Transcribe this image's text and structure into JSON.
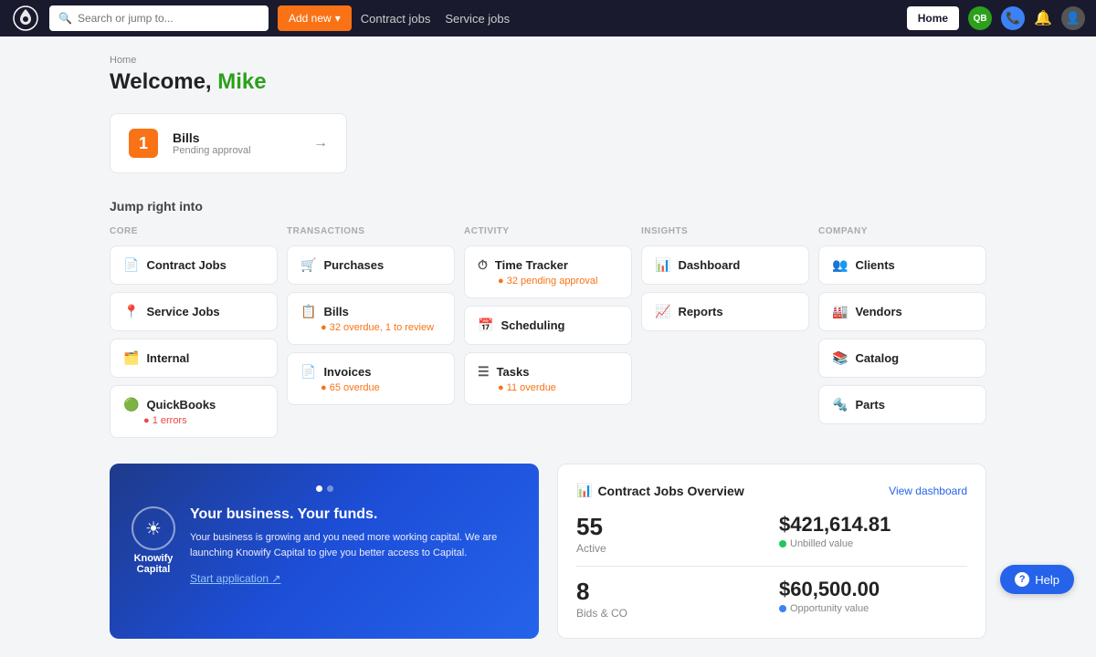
{
  "nav": {
    "logo_alt": "Knowify logo",
    "search_placeholder": "Search or jump to...",
    "btn_add_new": "Add new",
    "link_contract_jobs": "Contract jobs",
    "link_service_jobs": "Service jobs",
    "btn_home": "Home",
    "qb_label": "QB",
    "phone_icon": "📞",
    "bell_icon": "🔔",
    "user_icon": "👤"
  },
  "page": {
    "breadcrumb": "Home",
    "welcome_prefix": "Welcome, ",
    "welcome_name": "Mike"
  },
  "bills_card": {
    "badge": "1",
    "title": "Bills",
    "subtitle": "Pending approval",
    "arrow": "→"
  },
  "jump": {
    "title": "Jump right into",
    "columns": [
      {
        "label": "CORE",
        "items": [
          {
            "icon": "📄",
            "title": "Contract Jobs",
            "sub": "",
            "sub_class": ""
          },
          {
            "icon": "📍",
            "title": "Service Jobs",
            "sub": "",
            "sub_class": ""
          },
          {
            "icon": "🗂️",
            "title": "Internal",
            "sub": "",
            "sub_class": ""
          },
          {
            "icon": "🟢",
            "title": "QuickBooks",
            "sub": "● 1 errors",
            "sub_class": "red"
          }
        ]
      },
      {
        "label": "TRANSACTIONS",
        "items": [
          {
            "icon": "🛒",
            "title": "Purchases",
            "sub": "",
            "sub_class": ""
          },
          {
            "icon": "📋",
            "title": "Bills",
            "sub": "● 32 overdue, 1 to review",
            "sub_class": "orange"
          },
          {
            "icon": "📄",
            "title": "Invoices",
            "sub": "● 65 overdue",
            "sub_class": "orange"
          }
        ]
      },
      {
        "label": "ACTIVITY",
        "items": [
          {
            "icon": "⏱",
            "title": "Time Tracker",
            "sub": "● 32 pending approval",
            "sub_class": "orange"
          },
          {
            "icon": "📅",
            "title": "Scheduling",
            "sub": "",
            "sub_class": ""
          },
          {
            "icon": "☰",
            "title": "Tasks",
            "sub": "● 11 overdue",
            "sub_class": "orange"
          }
        ]
      },
      {
        "label": "INSIGHTS",
        "items": [
          {
            "icon": "📊",
            "title": "Dashboard",
            "sub": "",
            "sub_class": ""
          },
          {
            "icon": "📈",
            "title": "Reports",
            "sub": "",
            "sub_class": ""
          }
        ]
      },
      {
        "label": "COMPANY",
        "items": [
          {
            "icon": "👥",
            "title": "Clients",
            "sub": "",
            "sub_class": ""
          },
          {
            "icon": "🏭",
            "title": "Vendors",
            "sub": "",
            "sub_class": ""
          },
          {
            "icon": "📚",
            "title": "Catalog",
            "sub": "",
            "sub_class": ""
          },
          {
            "icon": "🔩",
            "title": "Parts",
            "sub": "",
            "sub_class": ""
          }
        ]
      }
    ]
  },
  "promo": {
    "dot1_active": true,
    "dot2_active": false,
    "logo_icon": "☀",
    "logo_text": "Knowify Capital",
    "headline": "Your business. Your funds.",
    "body": "Your business is growing and you need more working capital. We are launching Knowify Capital to give you better access to Capital.",
    "cta": "Start application ↗"
  },
  "overview": {
    "icon": "📊",
    "title": "Contract Jobs Overview",
    "view_link": "View dashboard",
    "stat1_number": "55",
    "stat1_label": "Active",
    "stat2_value": "$421,614.81",
    "stat2_dot": "green",
    "stat2_sub": "Unbilled value",
    "stat3_number": "8",
    "stat3_label": "Bids & CO",
    "stat4_value": "$60,500.00",
    "stat4_dot": "blue",
    "stat4_sub": "Opportunity value"
  },
  "help": {
    "label": "Help",
    "icon": "?"
  }
}
